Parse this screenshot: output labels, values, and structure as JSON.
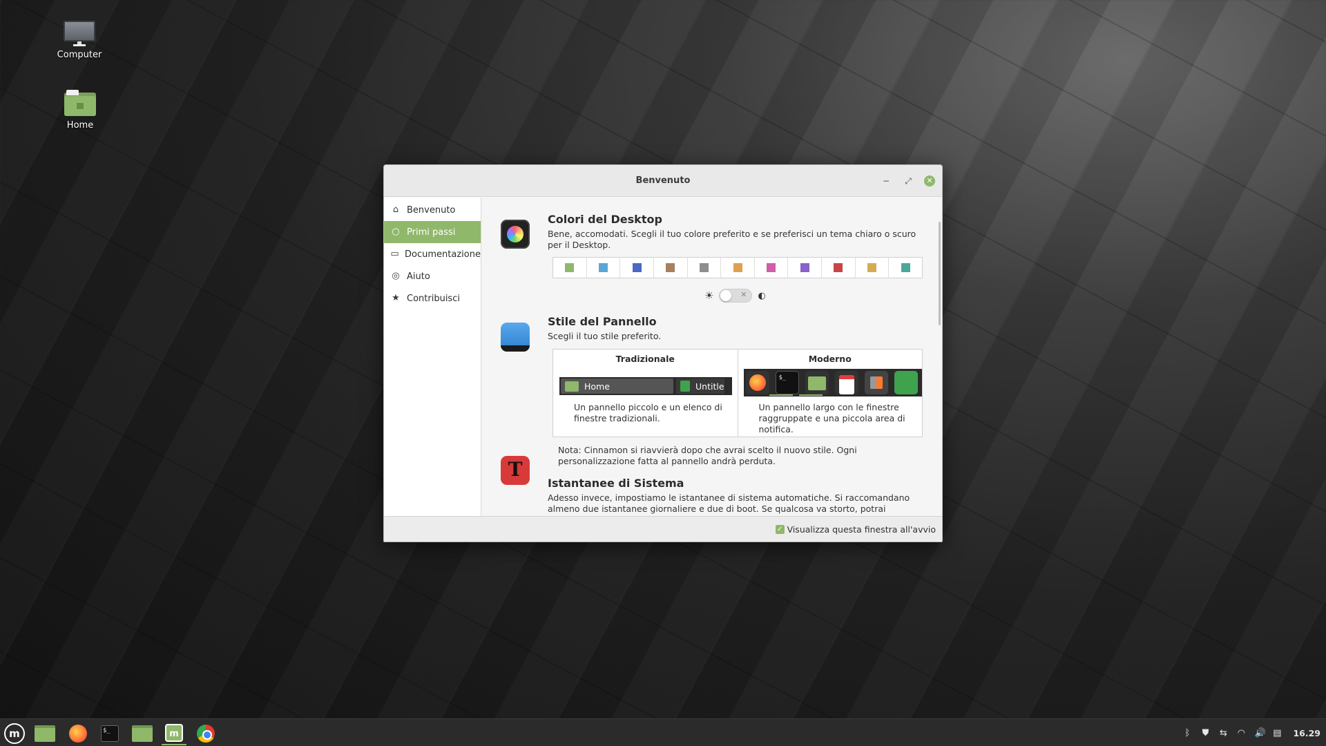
{
  "desktop": {
    "icons": [
      {
        "label": "Computer"
      },
      {
        "label": "Home"
      }
    ]
  },
  "window": {
    "title": "Benvenuto",
    "controls": {
      "minimize": "−",
      "maximize": "⤢",
      "close": "✕"
    },
    "sidebar": {
      "items": [
        {
          "label": "Benvenuto",
          "icon": "home-icon",
          "glyph": "⌂",
          "active": false
        },
        {
          "label": "Primi passi",
          "icon": "lightbulb-icon",
          "glyph": "💡",
          "active": true
        },
        {
          "label": "Documentazione",
          "icon": "book-icon",
          "glyph": "▭",
          "active": false
        },
        {
          "label": "Aiuto",
          "icon": "lifebuoy-icon",
          "glyph": "◎",
          "active": false
        },
        {
          "label": "Contribuisci",
          "icon": "star-icon",
          "glyph": "★",
          "active": false
        }
      ]
    },
    "sections": {
      "colors": {
        "title": "Colori del Desktop",
        "description": "Bene, accomodati. Scegli il tuo colore preferito e se preferisci un tema chiaro o scuro per il Desktop.",
        "swatches": [
          "#8fb86a",
          "#5aa7d6",
          "#4a68c4",
          "#a8805d",
          "#8e8e8e",
          "#e0a050",
          "#d05ea8",
          "#8a62c9",
          "#c94545",
          "#d4ab55",
          "#4aa89a"
        ],
        "theme_light_icon": "☀",
        "theme_dark_icon": "◐",
        "toggle_off_mark": "✕"
      },
      "panel": {
        "title": "Stile del Pannello",
        "description": "Scegli il tuo stile preferito.",
        "traditional": {
          "name": "Tradizionale",
          "preview_items": [
            "Home",
            "Untitle"
          ],
          "description": "Un pannello piccolo e un elenco di finestre tradizionali."
        },
        "modern": {
          "name": "Moderno",
          "terminal_prompt": "$_",
          "description": "Un pannello largo con le finestre raggruppate e una piccola area di notifica."
        },
        "note": "Nota: Cinnamon si riavvierà dopo che avrai scelto il nuovo stile. Ogni personalizzazione fatta al pannello andrà perduta."
      },
      "snapshots": {
        "title": "Istantanee di Sistema",
        "icon_letter": "T",
        "description": "Adesso invece, impostiamo le istantanee di sistema automatiche. Si raccomandano almeno due istantanee giornaliere e due di boot. Se qualcosa va storto, potrai ripristinare il tuo"
      }
    },
    "footer": {
      "checkbox_label": "Visualizza questa finestra all'avvio",
      "checked": true
    }
  },
  "taskbar": {
    "menu_glyph": "m",
    "welcome_glyph": "m",
    "terminal_glyph": "$_",
    "tray": {
      "icons": [
        {
          "name": "bluetooth-icon",
          "glyph": "ᛒ"
        },
        {
          "name": "shield-icon",
          "glyph": "⛊"
        },
        {
          "name": "network-icon",
          "glyph": "⇆"
        },
        {
          "name": "wifi-icon",
          "glyph": "◠"
        },
        {
          "name": "volume-icon",
          "glyph": "🔊"
        },
        {
          "name": "clipboard-icon",
          "glyph": "▤"
        }
      ],
      "clock": "16.29"
    }
  }
}
